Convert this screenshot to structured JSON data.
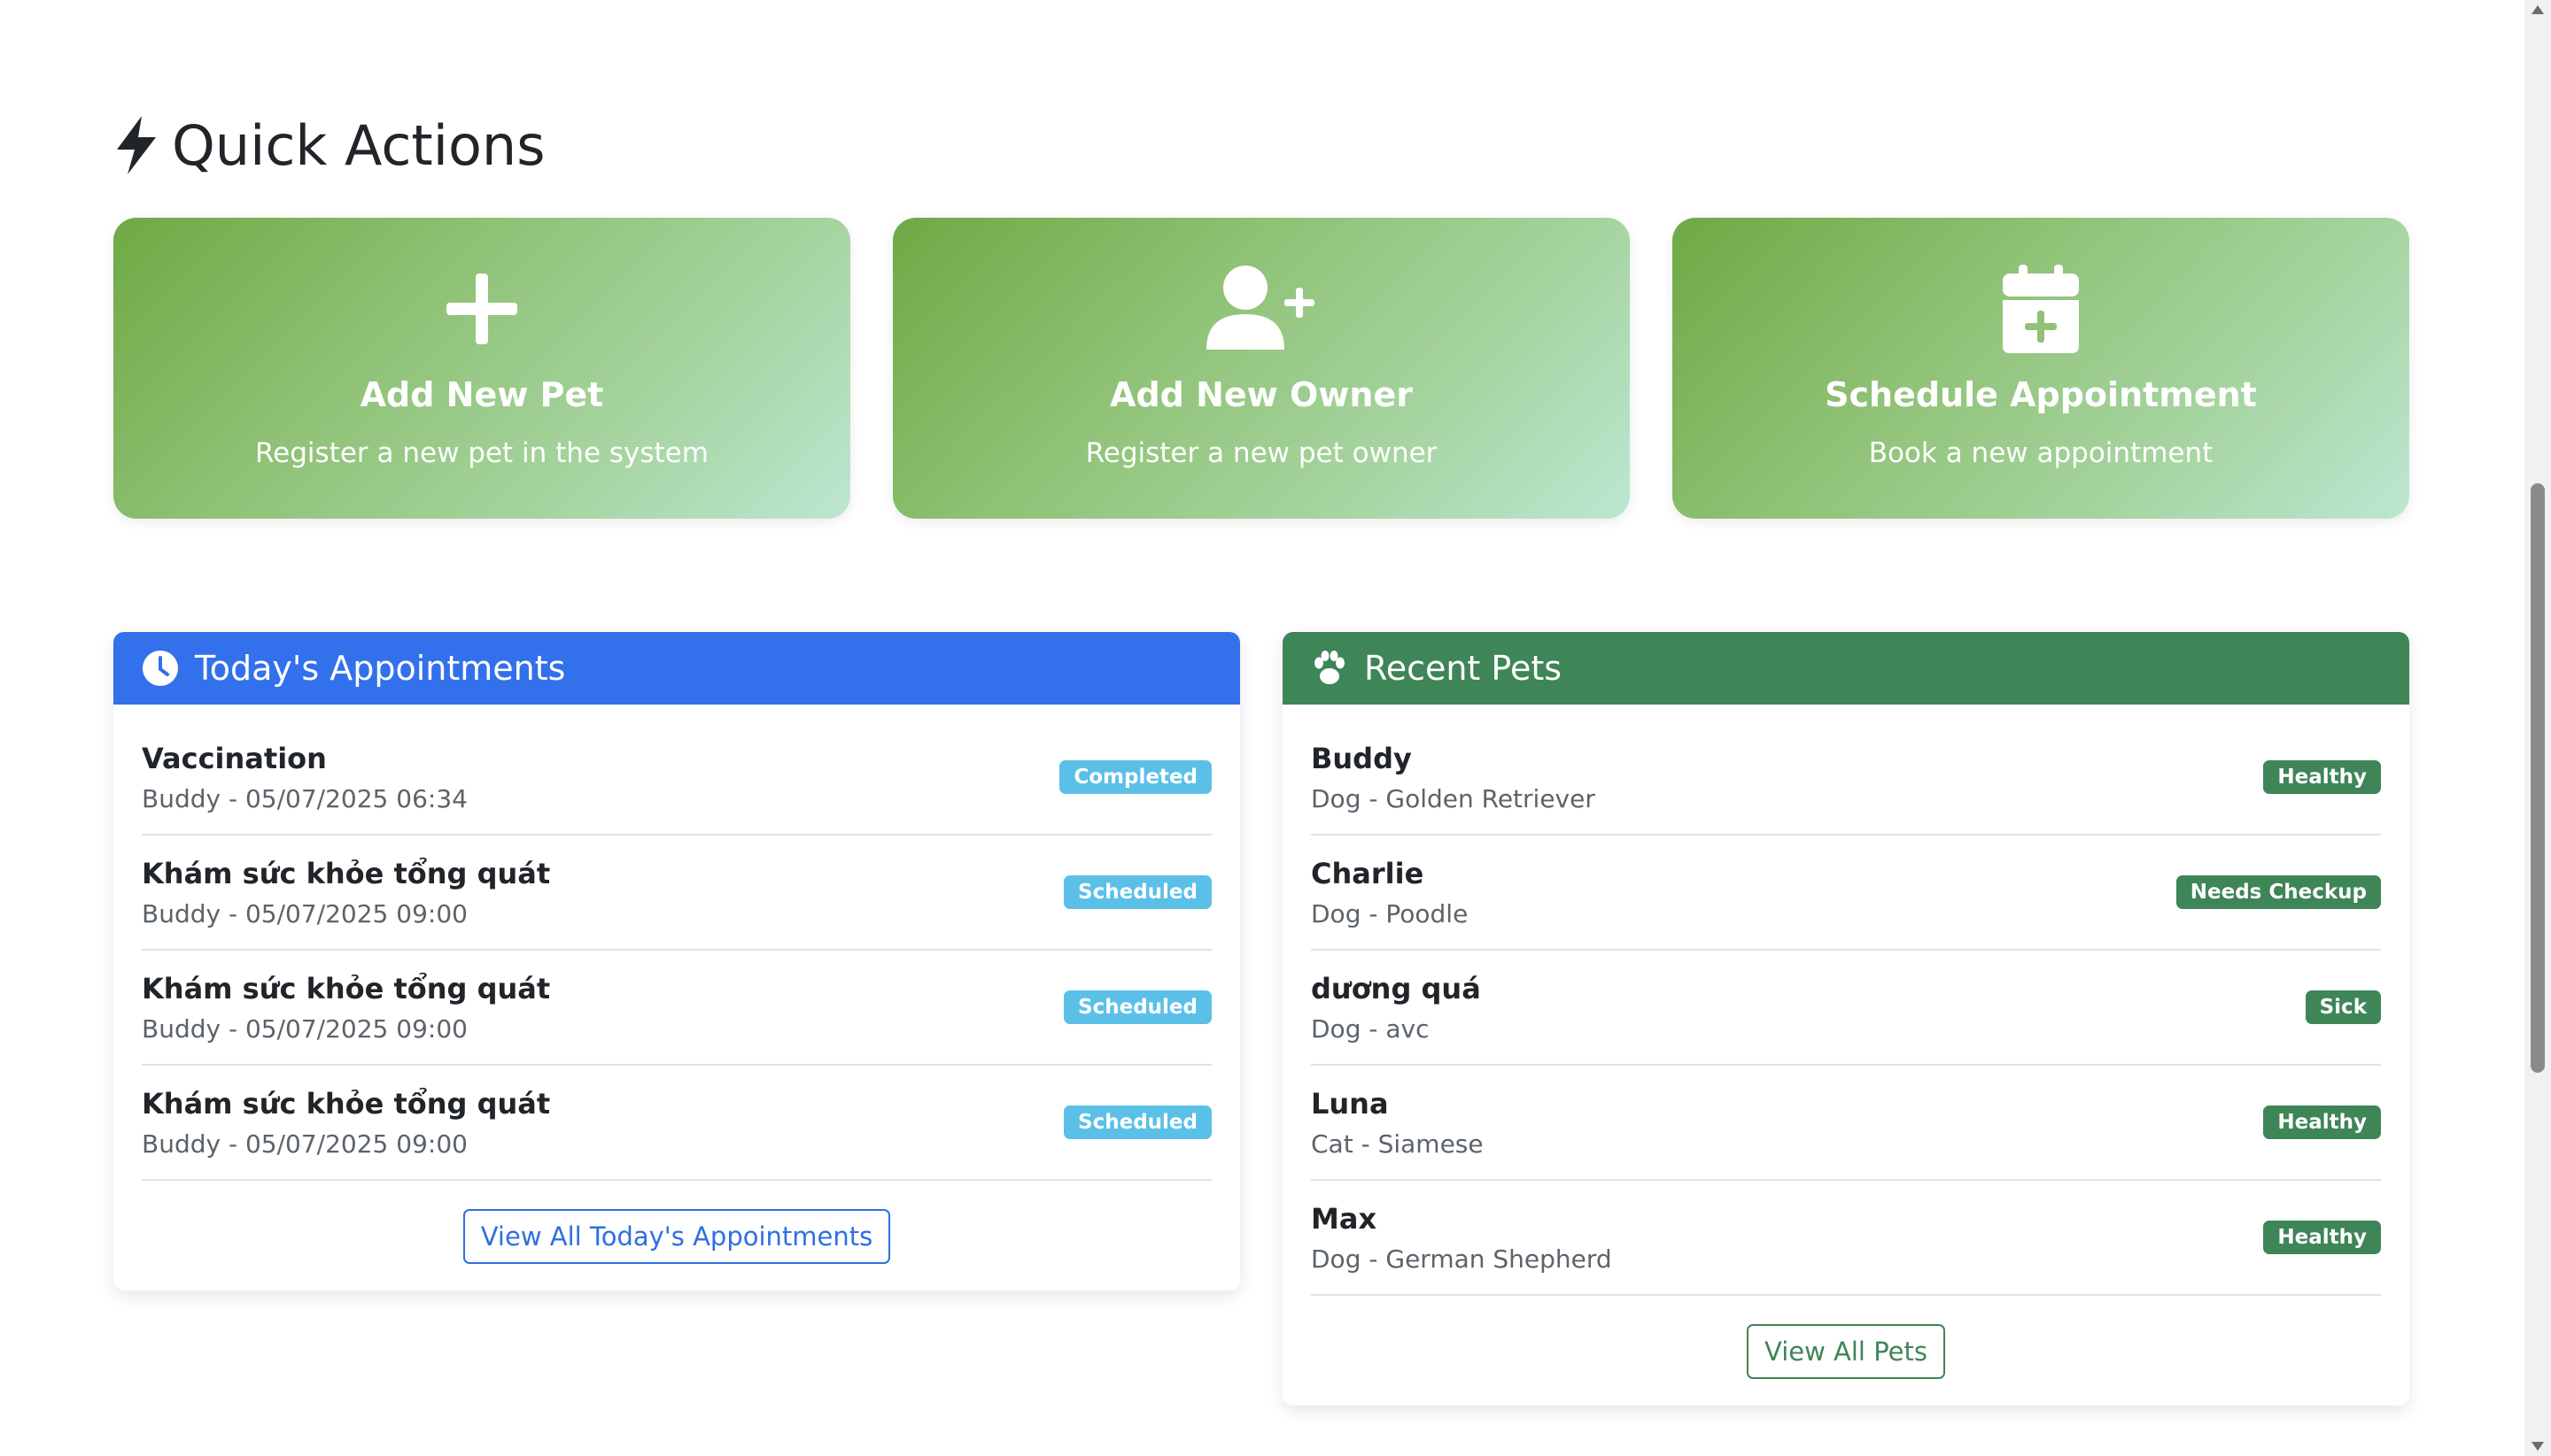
{
  "quick_actions": {
    "title": "Quick Actions",
    "cards": [
      {
        "title": "Add New Pet",
        "description": "Register a new pet in the system",
        "icon": "plus-icon"
      },
      {
        "title": "Add New Owner",
        "description": "Register a new pet owner",
        "icon": "user-plus-icon"
      },
      {
        "title": "Schedule Appointment",
        "description": "Book a new appointment",
        "icon": "calendar-plus-icon"
      }
    ]
  },
  "appointments": {
    "title": "Today's Appointments",
    "icon": "clock-icon",
    "header_color": "#3370eb",
    "items": [
      {
        "title": "Vaccination",
        "subtitle": "Buddy - 05/07/2025 06:34",
        "status": "Completed"
      },
      {
        "title": "Khám sức khỏe tổng quát",
        "subtitle": "Buddy - 05/07/2025 09:00",
        "status": "Scheduled"
      },
      {
        "title": "Khám sức khỏe tổng quát",
        "subtitle": "Buddy - 05/07/2025 09:00",
        "status": "Scheduled"
      },
      {
        "title": "Khám sức khỏe tổng quát",
        "subtitle": "Buddy - 05/07/2025 09:00",
        "status": "Scheduled"
      }
    ],
    "button_label": "View All Today's Appointments",
    "badge_color": "#5bc0e8",
    "button_color": "#2f6fe0"
  },
  "recent_pets": {
    "title": "Recent Pets",
    "icon": "paw-icon",
    "header_color": "#3e8557",
    "items": [
      {
        "name": "Buddy",
        "subtitle": "Dog - Golden Retriever",
        "status": "Healthy"
      },
      {
        "name": "Charlie",
        "subtitle": "Dog - Poodle",
        "status": "Needs Checkup"
      },
      {
        "name": "dương quá",
        "subtitle": "Dog - avc",
        "status": "Sick"
      },
      {
        "name": "Luna",
        "subtitle": "Cat - Siamese",
        "status": "Healthy"
      },
      {
        "name": "Max",
        "subtitle": "Dog - German Shepherd",
        "status": "Healthy"
      }
    ],
    "button_label": "View All Pets",
    "badge_color": "#3e8557",
    "button_color": "#3e8557"
  }
}
